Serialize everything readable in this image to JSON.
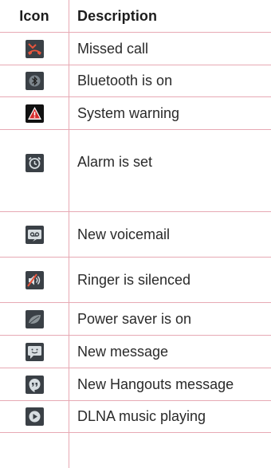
{
  "headers": {
    "icon": "Icon",
    "description": "Description"
  },
  "rows": [
    {
      "icon": "missed-call-icon",
      "label": "Missed call"
    },
    {
      "icon": "bluetooth-icon",
      "label": "Bluetooth is on"
    },
    {
      "icon": "warning-icon",
      "label": "System warning"
    },
    {
      "icon": "alarm-icon",
      "label": "Alarm is set"
    },
    {
      "icon": "voicemail-icon",
      "label": "New voicemail"
    },
    {
      "icon": "ringer-silenced-icon",
      "label": "Ringer is silenced"
    },
    {
      "icon": "power-saver-leaf-icon",
      "label": "Power saver is on"
    },
    {
      "icon": "message-icon",
      "label": "New message"
    },
    {
      "icon": "hangouts-icon",
      "label": "New Hangouts message"
    },
    {
      "icon": "dlna-play-icon",
      "label": "DLNA music playing"
    }
  ],
  "colors": {
    "rule": "#e7a9b4",
    "icon_bg": "#3a4046",
    "missed_call": "#e8553d",
    "warning": "#111111",
    "icon_fg": "#d7dde1"
  }
}
